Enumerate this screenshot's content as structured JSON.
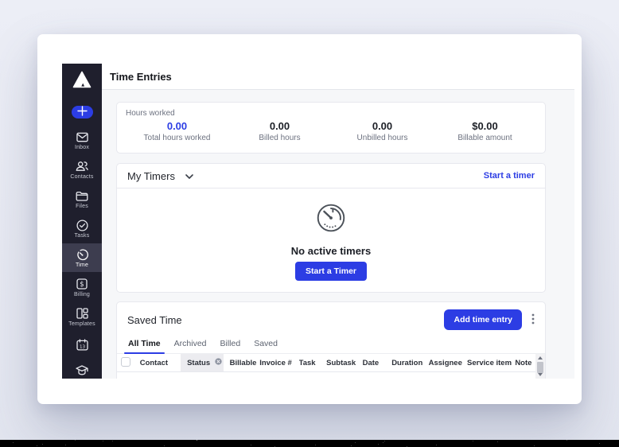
{
  "colors": {
    "accent": "#2c3de4",
    "sidebar_bg": "#1f1f2d",
    "sidebar_active_bg": "#3d3d4f",
    "content_bg": "#f6f7f9",
    "page_bg": "#e8eaf3"
  },
  "header": {
    "title": "Time Entries"
  },
  "sidebar": {
    "logo_icon": "triangle-logo-icon",
    "plus_button_icon": "plus-icon",
    "items": [
      {
        "label": "Inbox",
        "icon": "inbox-envelope-icon"
      },
      {
        "label": "Contacts",
        "icon": "contacts-people-icon"
      },
      {
        "label": "Files",
        "icon": "files-folder-icon"
      },
      {
        "label": "Tasks",
        "icon": "tasks-check-circle-icon"
      },
      {
        "label": "Time",
        "icon": "time-clock-icon",
        "active": true
      },
      {
        "label": "Billing",
        "icon": "billing-dollar-icon"
      },
      {
        "label": "Templates",
        "icon": "templates-layout-icon"
      },
      {
        "label": "",
        "icon": "calendar-icon"
      },
      {
        "label": "",
        "icon": "graduation-cap-icon"
      }
    ]
  },
  "stats": {
    "caption": "Hours worked",
    "items": [
      {
        "value": "0.00",
        "label": "Total hours worked",
        "highlight": true
      },
      {
        "value": "0.00",
        "label": "Billed hours"
      },
      {
        "value": "0.00",
        "label": "Unbilled hours"
      },
      {
        "value": "$0.00",
        "label": "Billable amount"
      }
    ]
  },
  "timers": {
    "title": "My Timers",
    "dropdown_icon": "chevron-down-icon",
    "start_link": "Start a timer",
    "illustration": "timer-stopwatch-icon",
    "empty_text": "No active timers",
    "start_button": "Start a Timer"
  },
  "saved": {
    "title": "Saved Time",
    "add_button": "Add time entry",
    "menu_icon": "kebab-menu-icon",
    "tabs": [
      {
        "label": "All Time",
        "active": true
      },
      {
        "label": "Archived"
      },
      {
        "label": "Billed"
      },
      {
        "label": "Saved"
      }
    ],
    "columns": [
      "Contact",
      "Status",
      "Billable",
      "Invoice #",
      "Task",
      "Subtask",
      "Date",
      "Duration",
      "Assignee",
      "Service item",
      "Note"
    ],
    "status_filter_clear_icon": "x-circle-icon"
  }
}
